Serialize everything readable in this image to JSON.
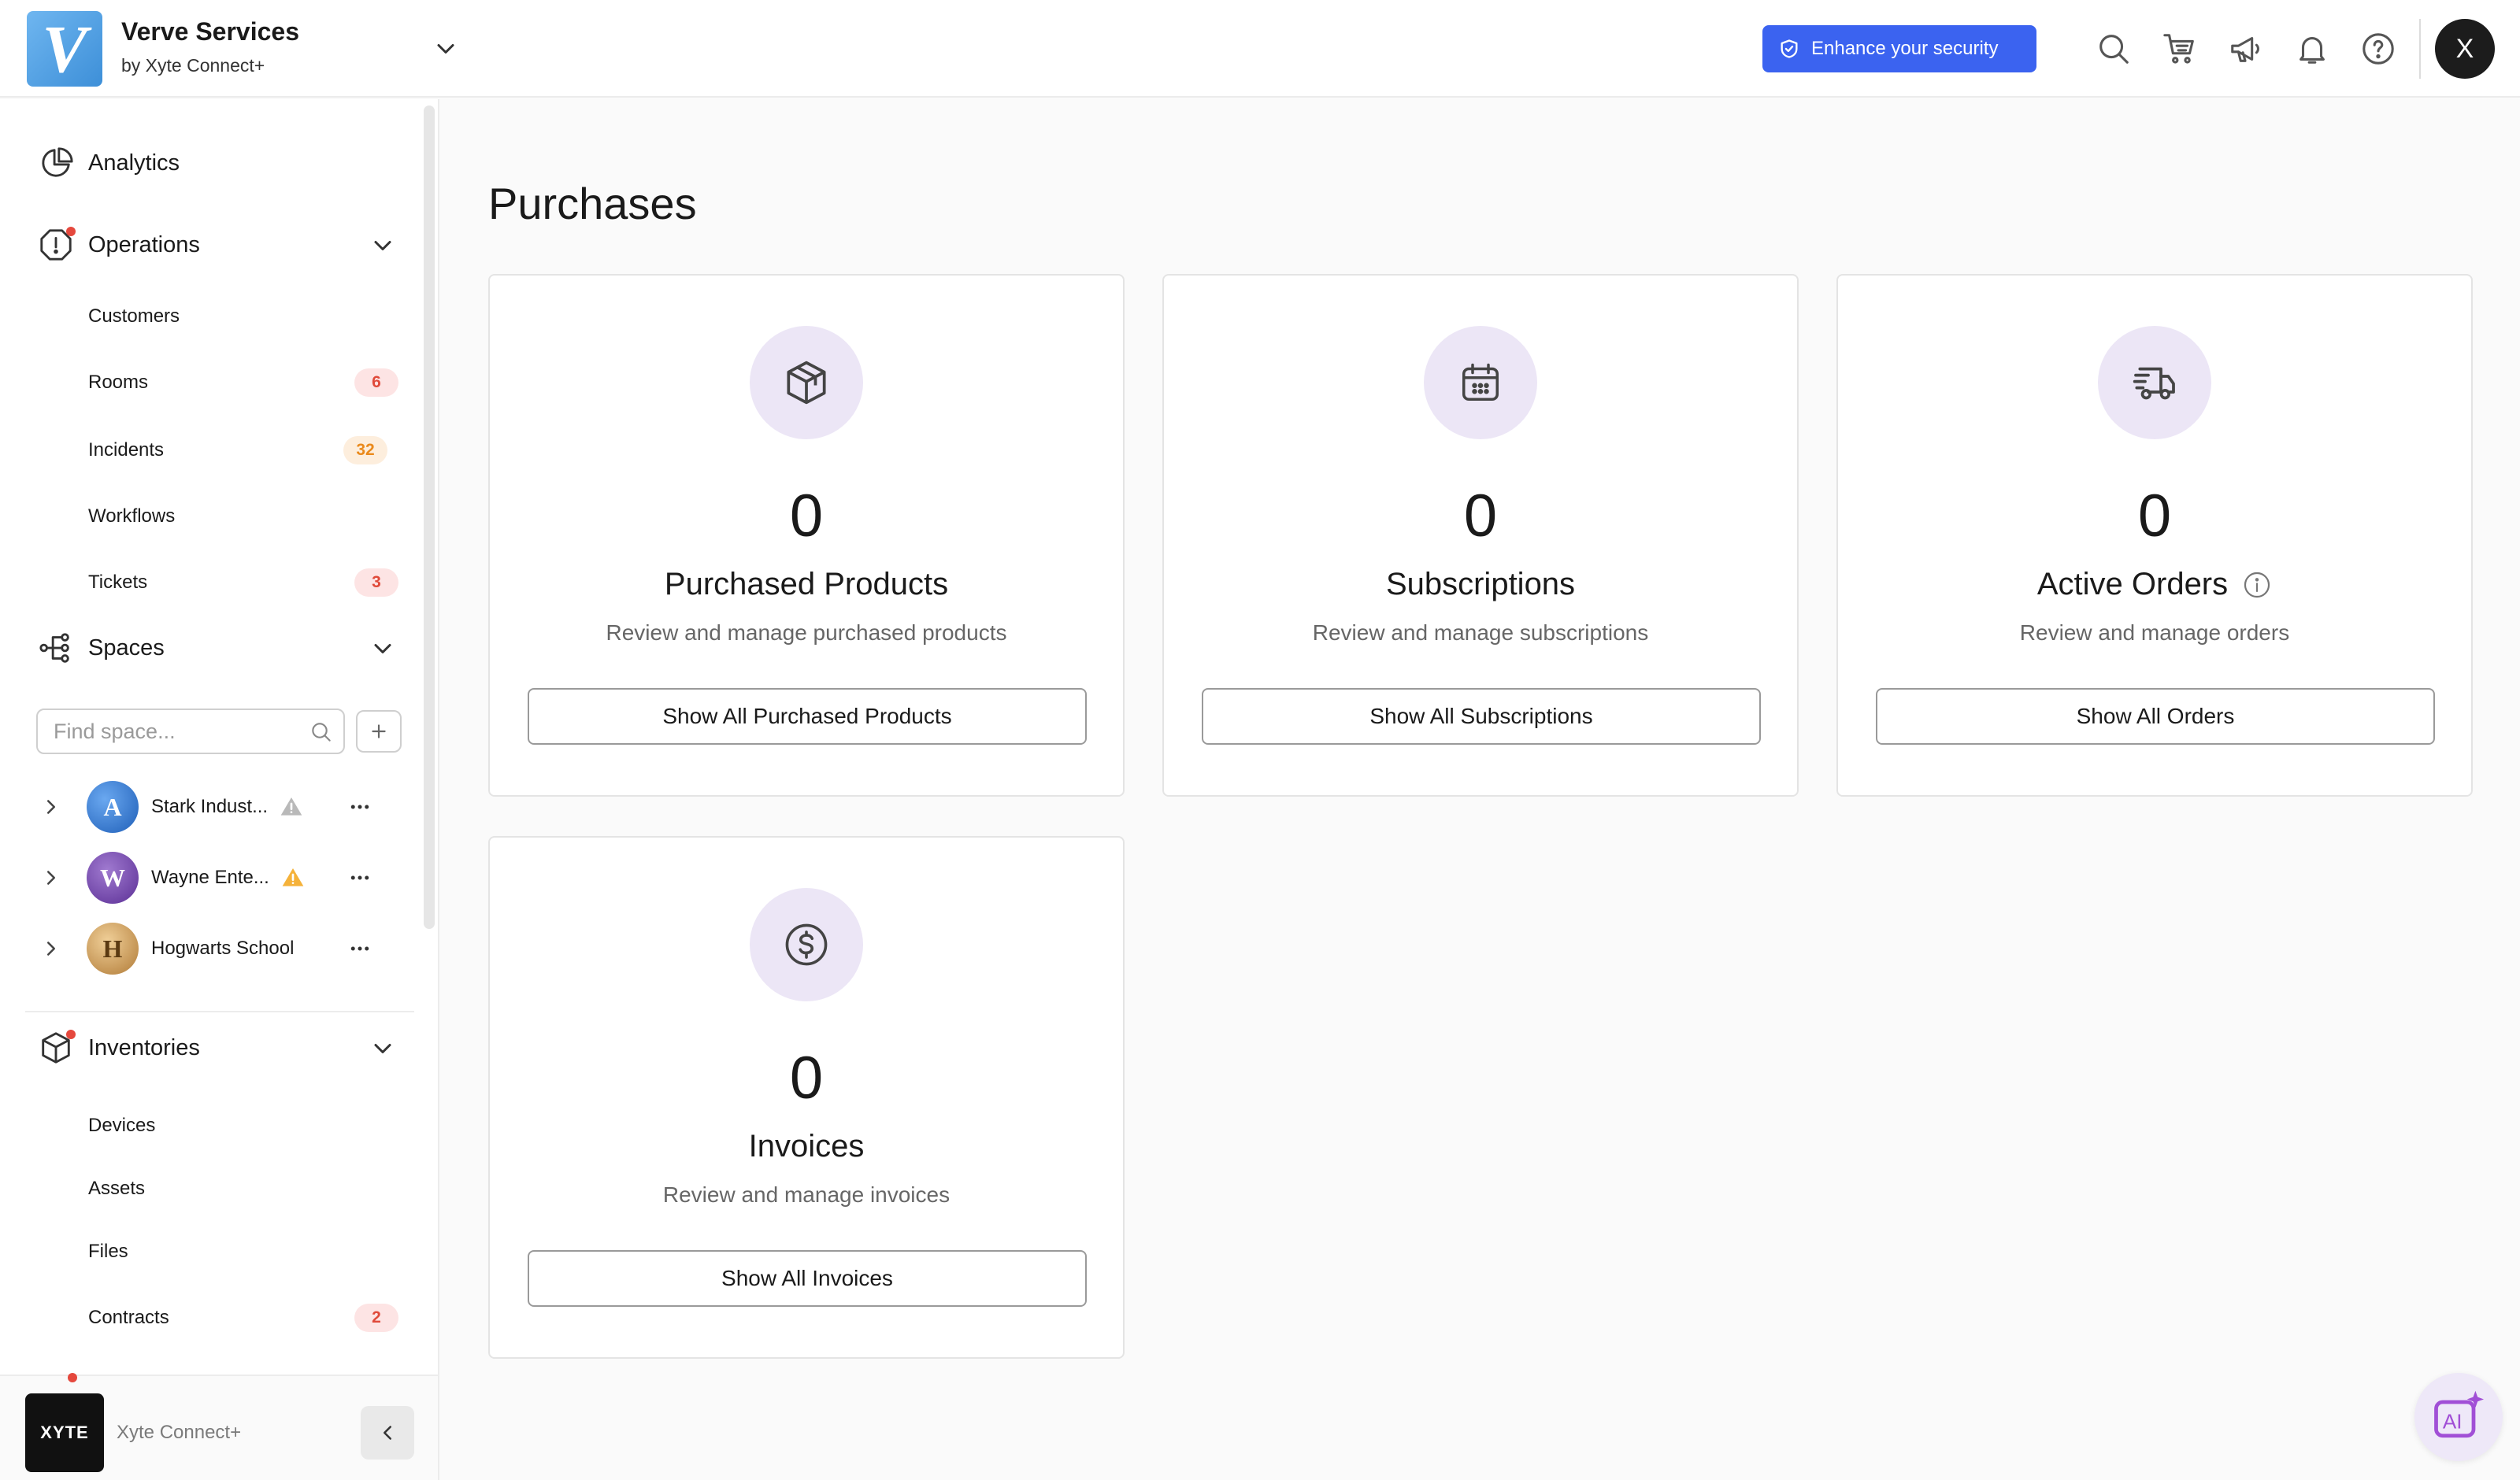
{
  "org": {
    "name": "Verve Services",
    "subtitle": "by Xyte Connect+",
    "logo_letter": "V"
  },
  "topbar": {
    "security_label": "Enhance your security",
    "icons": [
      "search-icon",
      "cart-icon",
      "megaphone-icon",
      "bell-icon",
      "help-icon"
    ],
    "avatar_letter": "X",
    "accent": "#3b63f0"
  },
  "sidebar": {
    "analytics": "Analytics",
    "operations": {
      "label": "Operations",
      "items": [
        {
          "label": "Customers"
        },
        {
          "label": "Rooms",
          "badge": "6"
        },
        {
          "label": "Incidents",
          "badge": "32"
        },
        {
          "label": "Workflows"
        },
        {
          "label": "Tickets",
          "badge": "3"
        }
      ]
    },
    "spaces": {
      "label": "Spaces",
      "search_placeholder": "Find space...",
      "items": [
        {
          "name": "Stark Indust...",
          "warning": "grey"
        },
        {
          "name": "Wayne Ente...",
          "warning": "yellow"
        },
        {
          "name": "Hogwarts School"
        }
      ]
    },
    "inventories": {
      "label": "Inventories",
      "items": [
        {
          "label": "Devices"
        },
        {
          "label": "Assets"
        },
        {
          "label": "Files"
        },
        {
          "label": "Contracts",
          "badge": "2"
        }
      ]
    },
    "footer": {
      "logo_text": "XYTE",
      "name": "Xyte Connect+"
    }
  },
  "main": {
    "title": "Purchases",
    "cards": [
      {
        "count": "0",
        "title": "Purchased Products",
        "desc": "Review and manage purchased products",
        "button": "Show All Purchased Products",
        "icon": "package-icon"
      },
      {
        "count": "0",
        "title": "Subscriptions",
        "desc": "Review and manage subscriptions",
        "button": "Show All Subscriptions",
        "icon": "calendar-icon"
      },
      {
        "count": "0",
        "title": "Active Orders",
        "desc": "Review and manage orders",
        "button": "Show All Orders",
        "icon": "truck-icon"
      },
      {
        "count": "0",
        "title": "Invoices",
        "desc": "Review and manage invoices",
        "button": "Show All Invoices",
        "icon": "dollar-icon"
      }
    ]
  },
  "ai_assistant": {
    "label": "AI"
  }
}
